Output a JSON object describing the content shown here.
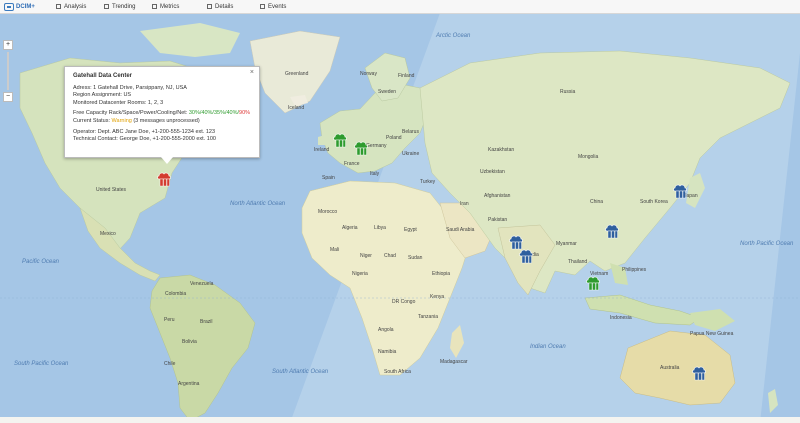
{
  "app": {
    "brand": "DCIM+"
  },
  "nav": [
    {
      "label": "Analysis"
    },
    {
      "label": "Trending"
    },
    {
      "label": "Metrics"
    },
    {
      "label": "Details"
    },
    {
      "label": "Events"
    }
  ],
  "map": {
    "zoom_in": "+",
    "zoom_out": "−",
    "labels": {
      "arctic_ocean": "Arctic Ocean",
      "greenland": "Greenland",
      "iceland": "Iceland",
      "canada": "Canada",
      "usa": "United States",
      "mexico": "Mexico",
      "n_atlantic": "North Atlantic Ocean",
      "s_atlantic": "South Atlantic Ocean",
      "pacific": "Pacific Ocean",
      "n_pacific": "North Pacific Ocean",
      "indian": "Indian Ocean",
      "brazil": "Brazil",
      "peru": "Peru",
      "colombia": "Colombia",
      "argentina": "Argentina",
      "chile": "Chile",
      "bolivia": "Bolivia",
      "venezuela": "Venezuela",
      "algeria": "Algeria",
      "libya": "Libya",
      "egypt": "Egypt",
      "mali": "Mali",
      "niger": "Niger",
      "chad": "Chad",
      "sudan": "Sudan",
      "nigeria": "Nigeria",
      "ethiopia": "Ethiopia",
      "kenya": "Kenya",
      "drc": "DR Congo",
      "tanzania": "Tanzania",
      "angola": "Angola",
      "namibia": "Namibia",
      "south_africa": "South Africa",
      "madagascar": "Madagascar",
      "russia": "Russia",
      "kazakhstan": "Kazakhstan",
      "mongolia": "Mongolia",
      "china": "China",
      "india": "India",
      "iran": "Iran",
      "saudi": "Saudi Arabia",
      "turkey": "Turkey",
      "pakistan": "Pakistan",
      "afghanistan": "Afghanistan",
      "japan": "Japan",
      "south_korea": "South Korea",
      "philippines": "Philippines",
      "thailand": "Thailand",
      "vietnam": "Vietnam",
      "myanmar": "Myanmar",
      "indonesia": "Indonesia",
      "papua": "Papua New Guinea",
      "australia": "Australia",
      "france": "France",
      "spain": "Spain",
      "germany": "Germany",
      "poland": "Poland",
      "ukraine": "Ukraine",
      "sweden": "Sweden",
      "finland": "Finland",
      "norway": "Norway",
      "ireland": "Ireland",
      "belarus": "Belarus",
      "italy": "Italy",
      "morocco": "Morocco",
      "uzbekistan": "Uzbekistan",
      "pacific_s": "South Pacific Ocean"
    }
  },
  "popup": {
    "title": "Gatehall Data Center",
    "close": "×",
    "address": "Adress: 1 Gatehall Drive, Parsippany, NJ, USA",
    "region": "Region Assignment: US",
    "rooms": "Monitored Datacenter Rooms: 1, 2, 3",
    "capacity_label": "Free Capacity Rack/Space/Power/Cooling/Net:",
    "capacity_ok": "30%/40%/35%/40%/",
    "capacity_bad": "90%",
    "status_label": "Current Status:",
    "status_value": "Warning",
    "status_note": "(3 messages unprocessed)",
    "operator": "Operator: Dept. ABC Jane Doe, +1-200-555-1234 ext. 123",
    "tech": "Technical Contact: George Doe, +1-200-555-2000 ext. 100"
  },
  "colors": {
    "ok": "#2e9b2e",
    "warning": "#e0a000",
    "critical": "#d33b2f",
    "info": "#2f5f9e"
  },
  "markers": [
    {
      "name": "datacenter-marker-parsippany",
      "status": "critical"
    },
    {
      "name": "datacenter-marker-uk",
      "status": "ok"
    },
    {
      "name": "datacenter-marker-netherlands",
      "status": "ok"
    },
    {
      "name": "datacenter-marker-japan",
      "status": "info"
    },
    {
      "name": "datacenter-marker-china",
      "status": "info"
    },
    {
      "name": "datacenter-marker-mumbai",
      "status": "info"
    },
    {
      "name": "datacenter-marker-bangalore",
      "status": "info"
    },
    {
      "name": "datacenter-marker-singapore",
      "status": "ok"
    },
    {
      "name": "datacenter-marker-australia",
      "status": "info"
    }
  ]
}
